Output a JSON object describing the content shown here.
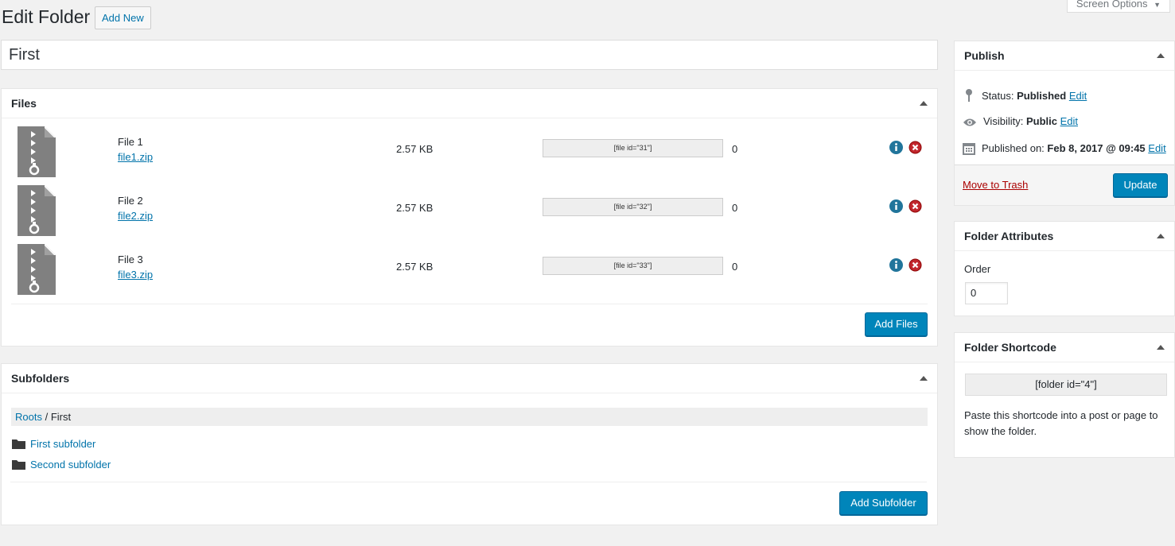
{
  "header": {
    "title": "Edit Folder",
    "add_new": "Add New",
    "screen_options": "Screen Options"
  },
  "post_title": "First",
  "files_box": {
    "title": "Files",
    "rows": [
      {
        "name": "File 1",
        "filename": "file1.zip",
        "size": "2.57 KB",
        "shortcode": "[file id=\"31\"]",
        "count": "0"
      },
      {
        "name": "File 2",
        "filename": "file2.zip",
        "size": "2.57 KB",
        "shortcode": "[file id=\"32\"]",
        "count": "0"
      },
      {
        "name": "File 3",
        "filename": "file3.zip",
        "size": "2.57 KB",
        "shortcode": "[file id=\"33\"]",
        "count": "0"
      }
    ],
    "add_button": "Add Files"
  },
  "subfolders_box": {
    "title": "Subfolders",
    "breadcrumb": {
      "root": "Roots",
      "separator": " / ",
      "current": "First"
    },
    "items": [
      "First subfolder",
      "Second subfolder"
    ],
    "add_button": "Add Subfolder"
  },
  "publish": {
    "title": "Publish",
    "status_label": "Status:",
    "status_value": "Published",
    "visibility_label": "Visibility:",
    "visibility_value": "Public",
    "published_label": "Published on:",
    "published_value": "Feb 8, 2017 @ 09:45",
    "edit": "Edit",
    "trash": "Move to Trash",
    "update": "Update"
  },
  "attributes": {
    "title": "Folder Attributes",
    "order_label": "Order",
    "order_value": "0"
  },
  "shortcode_box": {
    "title": "Folder Shortcode",
    "shortcode": "[folder id=\"4\"]",
    "description": "Paste this shortcode into a post or page to show the folder."
  },
  "colors": {
    "accent": "#0073aa",
    "primary_button": "#0085ba",
    "danger": "#a00",
    "delete_icon": "#c1272d"
  }
}
